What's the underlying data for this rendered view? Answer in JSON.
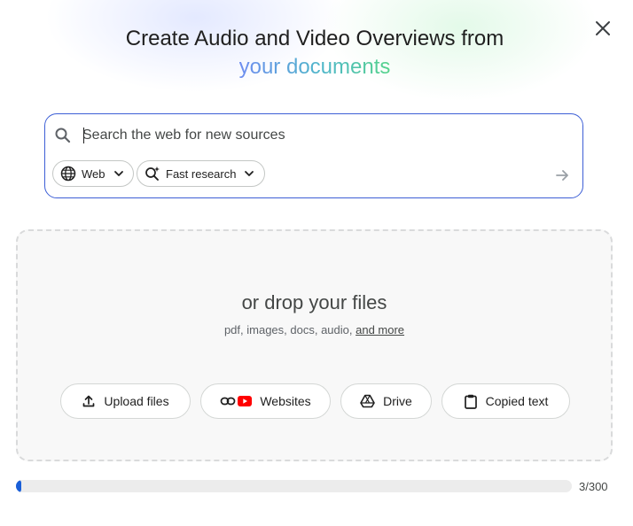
{
  "header": {
    "title_line1": "Create Audio and Video Overviews from",
    "title_line2": "your documents"
  },
  "search": {
    "placeholder": "Search the web for new sources",
    "value": "",
    "source_chip": "Web",
    "mode_chip": "Fast research"
  },
  "dropzone": {
    "title": "or drop your files",
    "subtitle": "pdf, images, docs, audio, ",
    "more_link": "and more",
    "buttons": {
      "upload": "Upload files",
      "websites": "Websites",
      "drive": "Drive",
      "copied": "Copied text"
    }
  },
  "limit": {
    "text": "3/300",
    "fraction": 0.01
  },
  "colors": {
    "accent": "#3d5fd6",
    "progress": "#1a5fd8",
    "youtube": "#ff0000"
  },
  "icons": {
    "close": "close-icon",
    "search": "search-icon",
    "globe": "globe-icon",
    "research": "sparkle-search-icon",
    "submit": "arrow-right-icon",
    "upload": "upload-icon",
    "link": "link-icon",
    "youtube": "youtube-icon",
    "drive": "drive-icon",
    "clipboard": "clipboard-icon"
  }
}
